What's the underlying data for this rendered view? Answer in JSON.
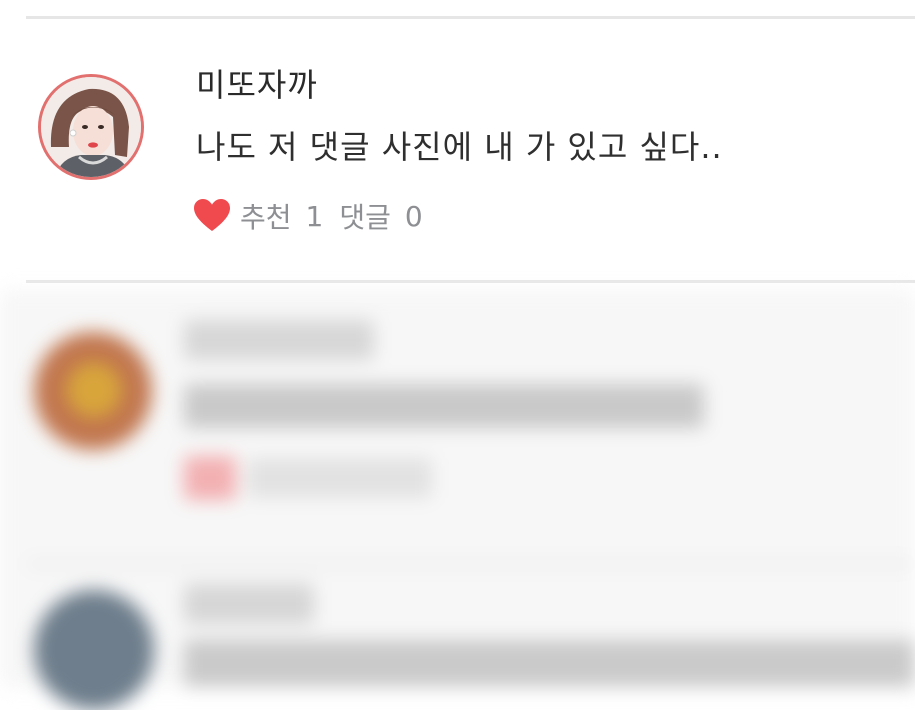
{
  "comment": {
    "author": "미또자까",
    "text": "나도 저 댓글 사진에 내 가 있고 싶다..",
    "likes_label": "추천",
    "likes_count": "1",
    "replies_label": "댓글",
    "replies_count": "0"
  },
  "icons": {
    "like": "heart-icon",
    "avatar": "profile-photo"
  },
  "colors": {
    "heart": "#f04a4f",
    "avatar_ring": "#e2706e",
    "meta_text": "#8d8f93",
    "divider": "#e6e6e6"
  }
}
